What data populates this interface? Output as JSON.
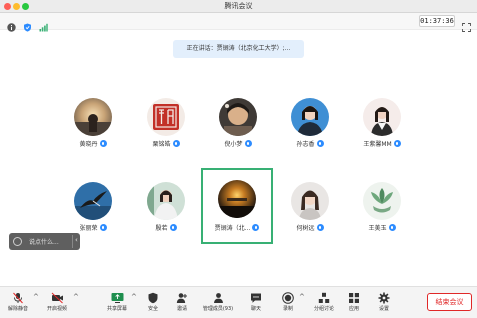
{
  "window": {
    "title": "腾讯会议"
  },
  "topbar": {
    "timer": "01:37:36"
  },
  "speaking": {
    "text": "正在讲话：贾锏涛（北京化工大学）;..."
  },
  "participants": [
    {
      "name": "黄晓丹"
    },
    {
      "name": "栗铭皓"
    },
    {
      "name": "倪小梦"
    },
    {
      "name": "孙志香"
    },
    {
      "name": "王紫馨MM"
    },
    {
      "name": "张丽荣"
    },
    {
      "name": "殷若"
    },
    {
      "name": "贾锏涛（北..."
    },
    {
      "name": "何树远"
    },
    {
      "name": "王美玉"
    }
  ],
  "chat": {
    "placeholder": "说点什么..."
  },
  "toolbar": {
    "mute": "解除静音",
    "video": "开启视频",
    "share": "共享屏幕",
    "security": "安全",
    "invite": "邀请",
    "members": "管理成员(93)",
    "chat": "聊天",
    "record": "录制",
    "breakout": "分组讨论",
    "apps": "应用",
    "settings": "设置",
    "end": "结束会议"
  },
  "colors": {
    "accent": "#2d8cff",
    "active_border": "#38b074",
    "end": "#e02828"
  }
}
